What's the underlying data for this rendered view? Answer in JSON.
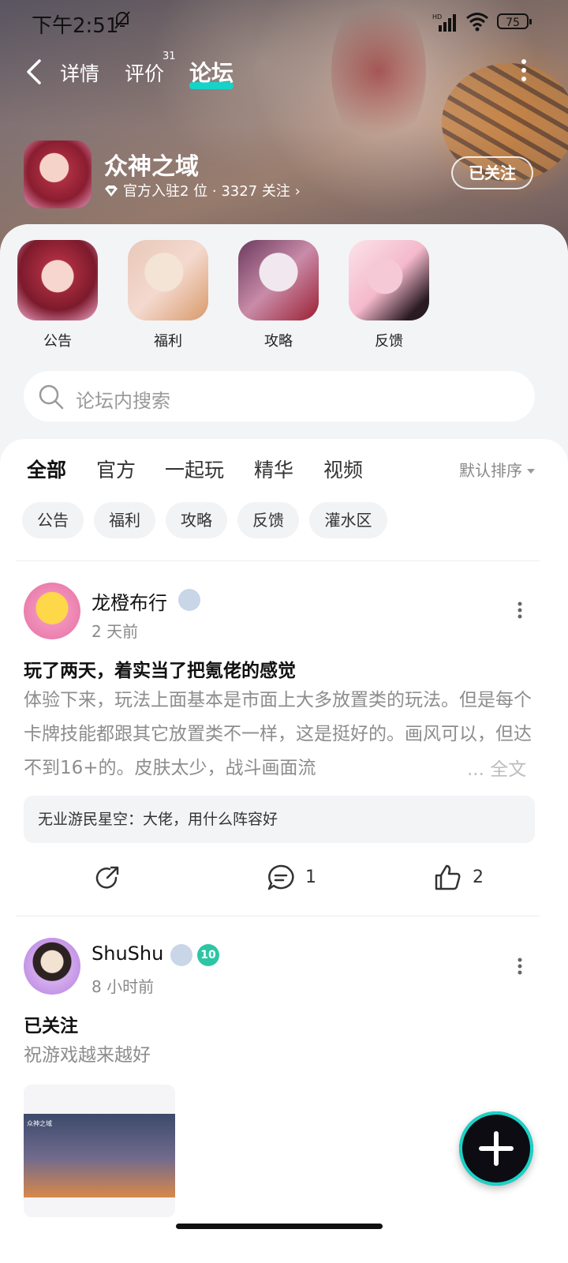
{
  "status_bar": {
    "time": "下午2:51",
    "network_label": "HD",
    "battery": "75"
  },
  "nav": {
    "tabs": [
      {
        "label": "详情"
      },
      {
        "label": "评价",
        "badge": "31"
      },
      {
        "label": "论坛"
      }
    ],
    "active_tab": "论坛"
  },
  "app": {
    "name": "众神之域",
    "meta": "官方入驻2 位 · 3327 关注 ›",
    "follow_label": "已关注"
  },
  "boards": [
    {
      "label": "公告"
    },
    {
      "label": "福利"
    },
    {
      "label": "攻略"
    },
    {
      "label": "反馈"
    }
  ],
  "search": {
    "placeholder": "论坛内搜索"
  },
  "feed_tabs": [
    {
      "label": "全部"
    },
    {
      "label": "官方"
    },
    {
      "label": "一起玩"
    },
    {
      "label": "精华"
    },
    {
      "label": "视频"
    }
  ],
  "sort_label": "默认排序",
  "chips": [
    {
      "label": "公告"
    },
    {
      "label": "福利"
    },
    {
      "label": "攻略"
    },
    {
      "label": "反馈"
    },
    {
      "label": "灌水区"
    }
  ],
  "posts": [
    {
      "author": "龙橙布行",
      "time": "2 天前",
      "title": "玩了两天，着实当了把氪佬的感觉",
      "body": "体验下来，玩法上面基本是市面上大多放置类的玩法。但是每个卡牌技能都跟其它放置类不一样，这是挺好的。画风可以，但达不到16+的。皮肤太少，战斗画面流",
      "ellipsis": "... 全文",
      "comment": "无业游民星空：大佬，用什么阵容好",
      "comments_count": "1",
      "likes_count": "2"
    },
    {
      "author": "ShuShu",
      "level": "10",
      "time": "8 小时前",
      "title": "已关注",
      "body": "祝游戏越来越好",
      "thumbnail_title": "众神之域"
    }
  ],
  "colors": {
    "accent": "#16d3c8",
    "level_badge": "#2ec5a5"
  }
}
